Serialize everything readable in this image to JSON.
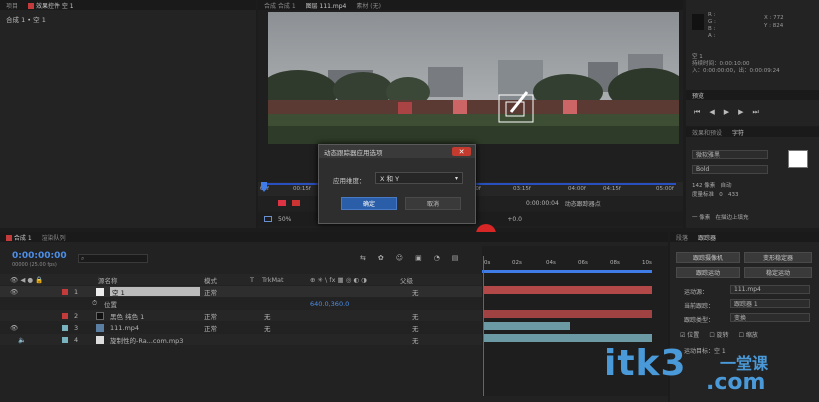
{
  "project_panel": {
    "tab1": "项目",
    "tab2": "效果控件 空 1",
    "header": "合成 1 • 空 1"
  },
  "comp_panel": {
    "tabs": [
      "合成 合成 1",
      "图层 111.mp4",
      "素材 (无)"
    ],
    "ruler_labels": [
      "00f",
      "00:15f",
      "01:00f",
      "01:15f",
      "03:00f",
      "03:15f",
      "04:00f",
      "04:15f",
      "05:00f"
    ],
    "zoom": "50%",
    "timecode": "0:00:00:04",
    "status": "动态跟踪器点",
    "track_value": "+0.0"
  },
  "dialog": {
    "title": "动态跟踪器应用选项",
    "label": "应用维度：",
    "value": "X 和 Y",
    "ok": "确定",
    "cancel": "取消"
  },
  "info_panel": {
    "r": "R :",
    "g": "G :",
    "b": "B :",
    "a": "A :",
    "x": "X : 772",
    "y": "Y : 824",
    "layer": "空 1",
    "duration": "持续时间：0:00:10:00",
    "in": "入：0:00:00:00，出：0:00:09:24",
    "preview_tab": "预览",
    "effects_tab": "效果和预设",
    "char_tab": "字符"
  },
  "character_panel": {
    "font": "微软雅黑",
    "style": "Bold",
    "size": "142 像素",
    "leading": "自动",
    "tracking": "度量标准",
    "tracking_val": "0",
    "kerning_val": "433",
    "stroke": "一 像素",
    "stroke_opt": "在描边上填充"
  },
  "timeline": {
    "tab": "合成 1",
    "tab2": "渲染队列",
    "timecode": "0:00:00:00",
    "fps": "00000 (25.00 fps)",
    "col_name": "源名称",
    "col_mode": "模式",
    "col_t": "T",
    "col_trkmat": "TrkMat",
    "col_parent": "父级",
    "ruler": [
      "0s",
      "02s",
      "04s",
      "06s",
      "08s",
      "10s"
    ],
    "layers": [
      {
        "num": "1",
        "name": "空 1",
        "mode": "正常",
        "trk": "",
        "parent": "无",
        "color": "#c43b3b"
      },
      {
        "num": "",
        "name": "位置",
        "mode": "",
        "trk": "",
        "parent": "",
        "value": "640.0,360.0"
      },
      {
        "num": "2",
        "name": "黑色 纯色 1",
        "mode": "正常",
        "trk": "无",
        "parent": "无",
        "color": "#c43b3b"
      },
      {
        "num": "3",
        "name": "111.mp4",
        "mode": "正常",
        "trk": "无",
        "parent": "无",
        "color": "#7ab3c0"
      },
      {
        "num": "4",
        "name": "旋制性的-Ra...com.mp3",
        "mode": "",
        "trk": "",
        "parent": "无",
        "color": "#7ab3c0"
      }
    ]
  },
  "tracker_panel": {
    "tab1": "段落",
    "tab2": "跟踪器",
    "btn1": "跟踪摄像机",
    "btn2": "变形稳定器",
    "btn3": "跟踪运动",
    "btn4": "稳定运动",
    "source_label": "运动源：",
    "source_val": "111.mp4",
    "current_label": "当前跟踪：",
    "current_val": "跟踪器 1",
    "type_label": "跟踪类型：",
    "type_val": "变换",
    "pos": "位置",
    "rot": "旋转",
    "scale": "缩放",
    "target": "运动目标：空 1"
  },
  "watermark": {
    "text": "itk3",
    "suffix": ".com",
    "cn": "一堂课"
  }
}
